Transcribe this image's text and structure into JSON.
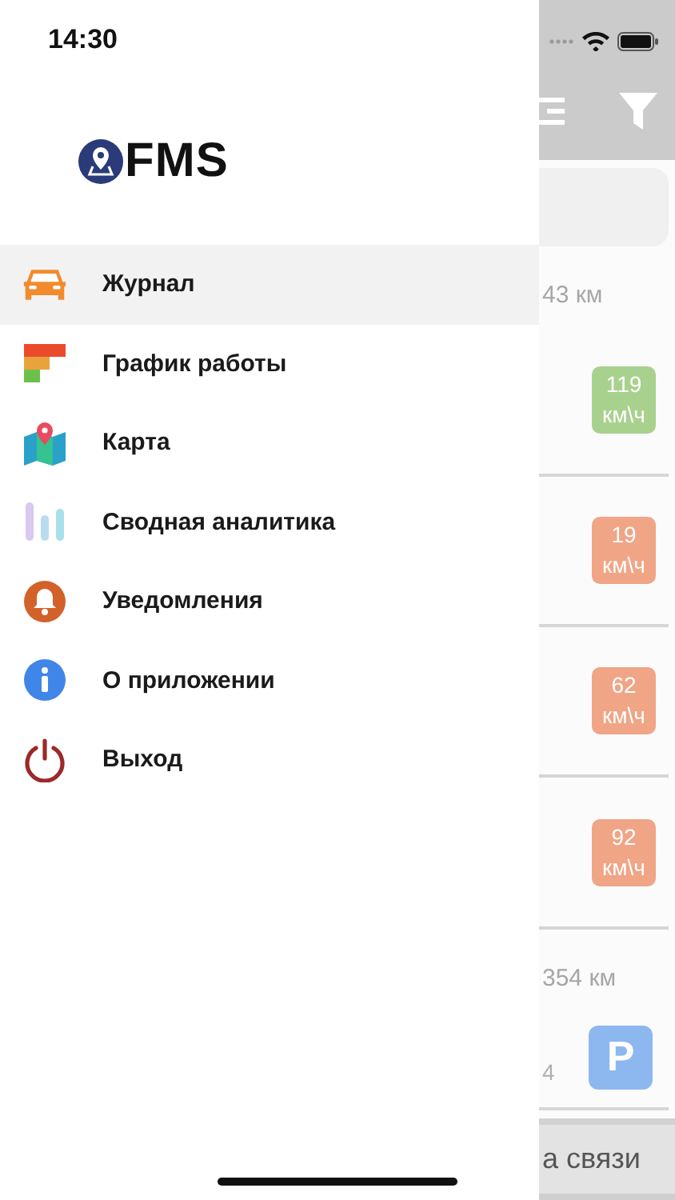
{
  "status_bar": {
    "time": "14:30"
  },
  "logo": {
    "text": "FMS"
  },
  "menu": [
    {
      "label": "Журнал",
      "kind": "car",
      "selected": true
    },
    {
      "label": "График работы",
      "kind": "schedule",
      "selected": false
    },
    {
      "label": "Карта",
      "kind": "map",
      "selected": false
    },
    {
      "label": "Сводная аналитика",
      "kind": "analytics",
      "selected": false
    },
    {
      "label": "Уведомления",
      "kind": "bell",
      "selected": false
    },
    {
      "label": "О приложении",
      "kind": "info",
      "selected": false
    },
    {
      "label": "Выход",
      "kind": "power",
      "selected": false
    }
  ],
  "background_screen": {
    "items": [
      {
        "kind": "distance",
        "text": "43 км"
      },
      {
        "kind": "speed",
        "value": "119",
        "unit": "км\\ч",
        "color": "#a9d18e"
      },
      {
        "kind": "speed",
        "value": "19",
        "unit": "км\\ч",
        "color": "#f0a586"
      },
      {
        "kind": "speed",
        "value": "62",
        "unit": "км\\ч",
        "color": "#f0a586"
      },
      {
        "kind": "speed",
        "value": "92",
        "unit": "км\\ч",
        "color": "#f0a586"
      },
      {
        "kind": "distance",
        "text": "354 км"
      },
      {
        "kind": "parking",
        "label": "P",
        "note": "4",
        "color": "#8db8ef"
      }
    ],
    "footer_bar": {
      "text": "а связи"
    }
  }
}
